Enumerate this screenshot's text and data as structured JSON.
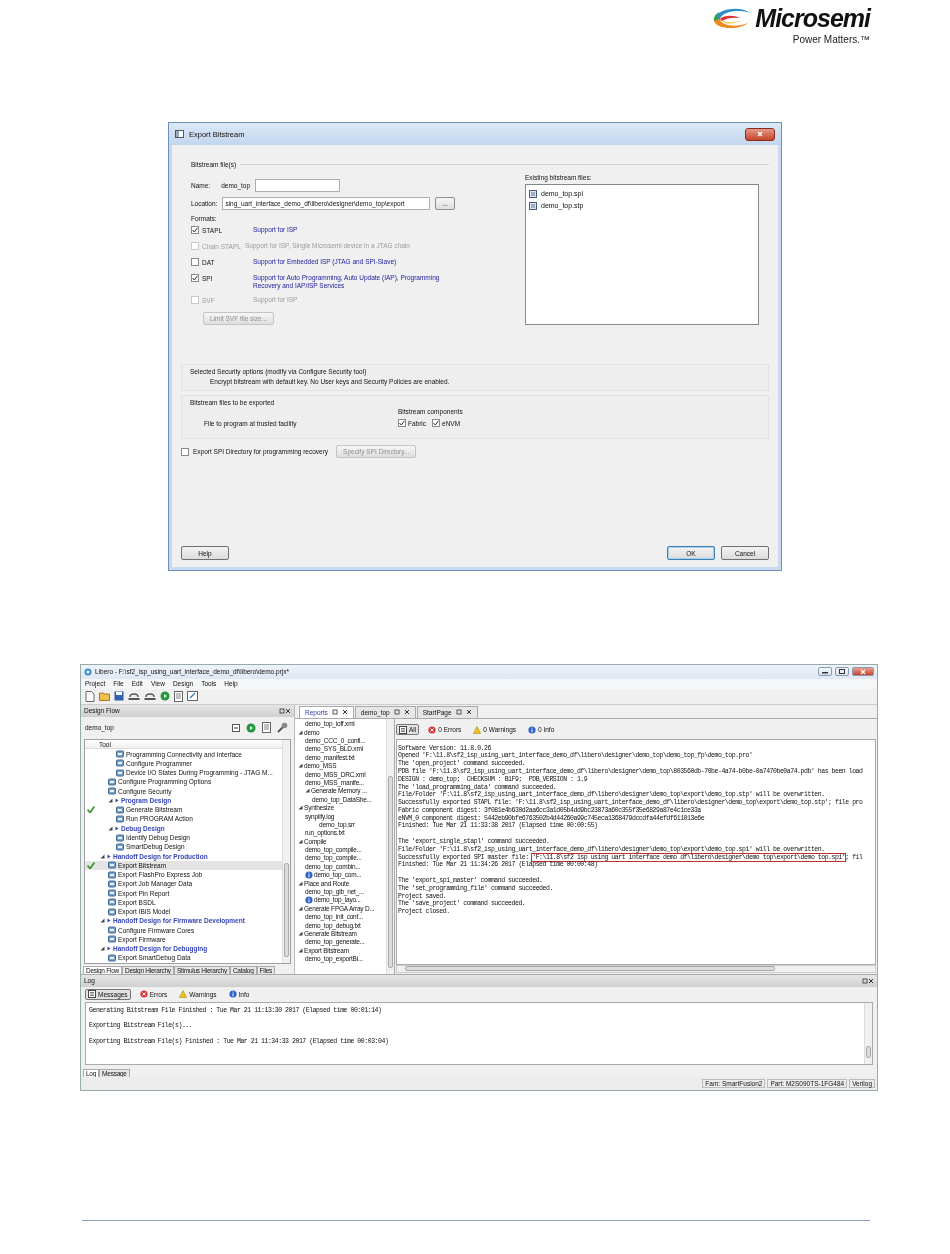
{
  "header": {
    "brand": "Microsemi",
    "tagline": "Power Matters.™"
  },
  "dialog": {
    "title": "Export Bitstream",
    "group_title": "Bitstream file(s)",
    "name_label": "Name:",
    "name_value": "demo_top",
    "location_label": "Location:",
    "location_value": "sing_uart_interface_demo_df\\libero\\designer\\demo_top\\export",
    "browse_button": "...",
    "formats_label": "Formats:",
    "formats": [
      {
        "label": "STAPL",
        "description": "Support for ISP",
        "checked": true,
        "disabled": false
      },
      {
        "label": "Chain STAPL",
        "description": "Support for ISP,  Single Microsemi device in a JTAG chain",
        "checked": false,
        "disabled": true
      },
      {
        "label": "DAT",
        "description": "Support for Embedded ISP (JTAG and SPI-Slave)",
        "checked": false,
        "disabled": false
      },
      {
        "label": "SPI",
        "description": "Support for Auto Programming, Auto Update (IAP), Programming Recovery and IAP/ISP Services",
        "checked": true,
        "disabled": false
      },
      {
        "label": "SVF",
        "description": "Support for ISP",
        "checked": false,
        "disabled": true
      }
    ],
    "limit_button": {
      "label": "Limit SVF file size...",
      "disabled": true
    },
    "existing_label": "Existing bitstream files:",
    "existing_files": [
      "demo_top.spi",
      "demo_top.stp"
    ],
    "security": {
      "title": "Selected Security options (modify via Configure Security tool)",
      "text": "Encrypt bitstream with default key. No User keys and Security Policies are enabled."
    },
    "export_group": {
      "title": "Bitstream files to be exported",
      "components_label": "Bitstream components",
      "row_label": "File to program at trusted facility",
      "components": [
        {
          "label": "Fabric",
          "checked": true
        },
        {
          "label": "eNVM",
          "checked": true
        }
      ]
    },
    "spi_directory": {
      "label": "Export SPI Directory for programming recovery",
      "checked": false,
      "button": "Specify SPI Directory...",
      "button_disabled": true
    },
    "buttons": [
      {
        "label": "Help",
        "default": false
      },
      {
        "label": "OK",
        "default": true
      },
      {
        "label": "Cancel",
        "default": false
      }
    ]
  },
  "libero": {
    "title": "Libero - F:\\sf2_isp_using_uart_interface_demo_df\\libero\\demo.prjx*",
    "menu": [
      "Project",
      "File",
      "Edit",
      "View",
      "Design",
      "Tools",
      "Help"
    ],
    "design_flow": {
      "panel_title": "Design Flow",
      "root": "demo_top",
      "column": "Tool",
      "tree": [
        {
          "children": [
            {
              "children": [
                {
                  "label": "Programming Connectivity and Interface",
                  "done": false,
                  "selected": false
                },
                {
                  "label": "Configure Programmer",
                  "done": false,
                  "selected": false
                },
                {
                  "label": "Device I/O States During Programming - JTAG M...",
                  "done": false,
                  "selected": false
                }
              ]
            },
            {
              "label": "Configure Programming Options",
              "done": false,
              "selected": false
            },
            {
              "label": "Configure Security",
              "done": false,
              "selected": false
            },
            {
              "label": "Program Design",
              "expanded": true,
              "children": [
                {
                  "label": "Generate Bitstream",
                  "done": true,
                  "selected": false
                },
                {
                  "label": "Run PROGRAM Action",
                  "done": false,
                  "selected": false
                }
              ]
            },
            {
              "label": "Debug Design",
              "expanded": true,
              "children": [
                {
                  "label": "Identify Debug Design",
                  "done": false,
                  "selected": false
                },
                {
                  "label": "SmartDebug Design",
                  "done": false,
                  "selected": false
                }
              ]
            }
          ]
        },
        {
          "label": "Handoff Design for Production",
          "expanded": true,
          "children": [
            {
              "label": "Export Bitstream",
              "done": true,
              "selected": true
            },
            {
              "label": "Export FlashPro Express Job",
              "done": false,
              "selected": false
            },
            {
              "label": "Export Job Manager Data",
              "done": false,
              "selected": false
            },
            {
              "label": "Export Pin Report",
              "done": false,
              "selected": false
            },
            {
              "label": "Export BSDL",
              "done": false,
              "selected": false
            },
            {
              "label": "Export IBIS Model",
              "done": false,
              "selected": false
            }
          ]
        },
        {
          "label": "Handoff Design for Firmware Development",
          "expanded": true,
          "children": [
            {
              "label": "Configure Firmware Cores",
              "done": false,
              "selected": false
            },
            {
              "label": "Export Firmware",
              "done": false,
              "selected": false
            }
          ]
        },
        {
          "label": "Handoff Design for Debugging",
          "expanded": true,
          "children": [
            {
              "label": "Export SmartDebug Data",
              "done": false,
              "selected": false
            }
          ]
        }
      ],
      "tabs": [
        {
          "label": "Design Flow",
          "selected": true
        },
        {
          "label": "Design Hierarchy",
          "selected": false
        },
        {
          "label": "Stimulus Hierarchy",
          "selected": false
        },
        {
          "label": "Catalog",
          "selected": false
        },
        {
          "label": "Files",
          "selected": false
        }
      ]
    },
    "doc_tabs": [
      {
        "label": "Reports",
        "selected": true
      },
      {
        "label": "demo_top",
        "selected": false
      },
      {
        "label": "StartPage",
        "selected": false
      }
    ],
    "reports": [
      {
        "children": [
          {
            "label": "demo_top_ioff.xml"
          }
        ]
      },
      {
        "label": "demo",
        "expanded": true,
        "children": [
          {
            "label": "demo_CCC_0_confi..."
          },
          {
            "label": "demo_SYS_BLD.xml"
          },
          {
            "label": "demo_manifest.txt"
          }
        ]
      },
      {
        "label": "demo_MSS",
        "expanded": true,
        "children": [
          {
            "label": "demo_MSS_DRC.xml"
          },
          {
            "label": "demo_MSS_manife..."
          },
          {
            "label": "Generate Memory ...",
            "expanded": true,
            "children": [
              {
                "label": "demo_top_DataShe..."
              }
            ]
          }
        ]
      },
      {
        "label": "Synthesize",
        "expanded": true,
        "children": [
          {
            "label": "synplify.log",
            "children": [
              {
                "label": "demo_top.srr"
              }
            ]
          },
          {
            "label": "run_options.txt"
          }
        ]
      },
      {
        "label": "Compile",
        "expanded": true,
        "children": [
          {
            "label": "demo_top_compile..."
          },
          {
            "label": "demo_top_compile..."
          },
          {
            "label": "demo_top_combin..."
          },
          {
            "label": "demo_top_com...",
            "kind": "info"
          }
        ]
      },
      {
        "label": "Place and Route",
        "expanded": true,
        "children": [
          {
            "label": "demo_top_glb_net_..."
          },
          {
            "label": "demo_top_layo...",
            "kind": "info"
          }
        ]
      },
      {
        "label": "Generate FPGA Array D...",
        "expanded": true,
        "children": [
          {
            "label": "demo_top_init_conf..."
          },
          {
            "label": "demo_top_debug.txt"
          }
        ]
      },
      {
        "label": "Generate Bitstream",
        "expanded": true,
        "children": [
          {
            "label": "demo_top_generate..."
          }
        ]
      },
      {
        "label": "Export Bitstream",
        "expanded": true,
        "children": [
          {
            "label": "demo_top_exportBi..."
          }
        ]
      }
    ],
    "report_filters": [
      {
        "label": "All",
        "kind": "all",
        "selected": true
      },
      {
        "label": "0 Errors",
        "kind": "error",
        "selected": false
      },
      {
        "label": "0 Warnings",
        "kind": "warning",
        "selected": false
      },
      {
        "label": "0 Info",
        "kind": "info",
        "selected": false
      }
    ],
    "report_lines": [
      {
        "text": "Software Version: 11.8.0.26"
      },
      {
        "text": "Opened 'F:\\11.8\\sf2_isp_using_uart_interface_demo_df\\libero\\designer\\demo_top\\demo_top_fp\\demo_top.pro'"
      },
      {
        "text": "The 'open_project' command succeeded."
      },
      {
        "text": "PDB file 'F:\\11.8\\sf2_isp_using_uart_interface_demo_df\\libero\\designer\\demo_top\\803560db-70be-4a74-b0be-0a7470be0a74.pdb' has been load"
      },
      {
        "text": "DESIGN : demo_top;  CHECKSUM : B1F9;  PDB_VERSION : 1.9"
      },
      {
        "text": "The 'load_programming_data' command succeeded."
      },
      {
        "text": "File/Folder 'F:\\11.8\\sf2_isp_using_uart_interface_demo_df\\libero\\designer\\demo_top\\export\\demo_top.stp' will be overwritten."
      },
      {
        "text": "Successfully exported STAPL file: 'F:\\11.8\\sf2_isp_using_uart_interface_demo_df\\libero\\designer\\demo_top\\export\\demo_top.stp'; file pro"
      },
      {
        "text": "Fabric component digest: 3f081e4b630d2aa6cc3a1d05b4dd9bc23873a60c355f35e6829a87e4c1ce33a"
      },
      {
        "text": "eNVM_0 component digest: 5442eb90bfe6763502b4d44260a99c745eca1368479dccdfa44efdf611013e6e"
      },
      {
        "text": "Finished: Tue Mar 21 11:33:38 2017 (Elapsed time 00:00:55)"
      },
      {
        "text": "The 'export_single_stapl' command succeeded.",
        "gap_before": true
      },
      {
        "text": "File/Folder 'F:\\11.8\\sf2_isp_using_uart_interface_demo_df\\libero\\designer\\demo_top\\export\\demo_top.spi' will be overwritten."
      },
      {
        "text": "Successfully exported SPI master file: ",
        "highlight": "'F:\\11.8\\sf2 isp using uart interface demo df\\libero\\designer\\demo top\\export\\demo top.spi'",
        "after": "; fil"
      },
      {
        "text": "Finished: Tue Mar 21 11:34:26 2017 (Elapsed time 00:00:48)"
      },
      {
        "text": "The 'export_spi_master' command succeeded.",
        "gap_before": true
      },
      {
        "text": "The 'set_programming_file' command succeeded."
      },
      {
        "text": "Project saved."
      },
      {
        "text": "The 'save_project' command succeeded."
      },
      {
        "text": "Project closed."
      }
    ],
    "log": {
      "title": "Log",
      "filters": [
        {
          "label": "Messages",
          "kind": "all",
          "selected": true
        },
        {
          "label": "Errors",
          "kind": "error",
          "selected": false
        },
        {
          "label": "Warnings",
          "kind": "warning",
          "selected": false
        },
        {
          "label": "Info",
          "kind": "info",
          "selected": false
        }
      ],
      "lines": [
        {
          "text": "Generating Bitstream File Finished : Tue Mar 21 11:13:30 2017 (Elapsed time 00:01:14)"
        },
        {
          "text": "Exporting Bitstream File(s)...",
          "gap_before": true
        },
        {
          "text": "Exporting Bitstream File(s) Finished : Tue Mar 21 11:34:33 2017 (Elapsed time 00:03:04)",
          "gap_before": true
        }
      ],
      "tabs": [
        {
          "label": "Log",
          "selected": true
        },
        {
          "label": "Message",
          "selected": false
        }
      ]
    },
    "status_bar": [
      "Fam: SmartFusion2",
      "Part: M2S090TS-1FG484",
      "Verilog"
    ]
  }
}
